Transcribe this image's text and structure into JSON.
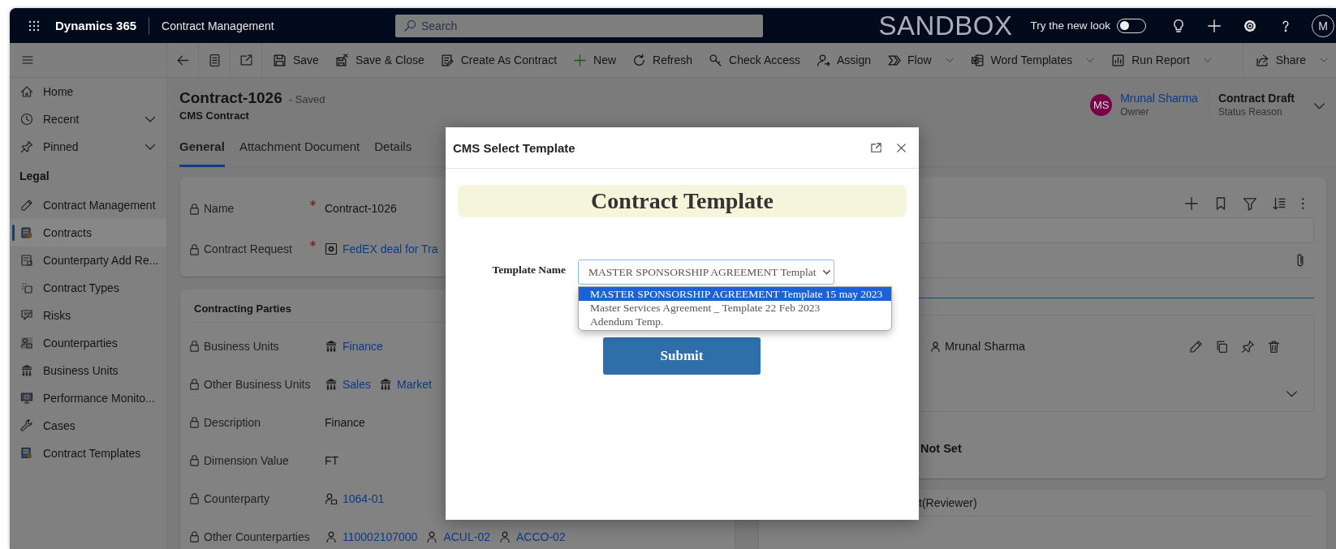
{
  "top_bar": {
    "app_name": "Dynamics 365",
    "area": "Contract Management",
    "search": {
      "placeholder": "Search"
    },
    "environment": "SANDBOX",
    "new_look": {
      "label": "Try the new look",
      "on": false
    },
    "user_initial": "M"
  },
  "command_bar": {
    "items": [
      {
        "label": "Save",
        "kind": "button"
      },
      {
        "label": "Save & Close",
        "kind": "button"
      },
      {
        "label": "Create As Contract",
        "kind": "button"
      },
      {
        "label": "New",
        "kind": "button"
      },
      {
        "label": "Refresh",
        "kind": "button"
      },
      {
        "label": "Check Access",
        "kind": "button"
      },
      {
        "label": "Assign",
        "kind": "button"
      },
      {
        "label": "Flow",
        "kind": "menu"
      },
      {
        "label": "Word Templates",
        "kind": "menu"
      },
      {
        "label": "Run Report",
        "kind": "menu"
      }
    ],
    "share": {
      "label": "Share",
      "kind": "menu"
    }
  },
  "sidebar": {
    "items": [
      {
        "label": "Home",
        "expandable": false,
        "selected": false
      },
      {
        "label": "Recent",
        "expandable": true,
        "selected": false
      },
      {
        "label": "Pinned",
        "expandable": true,
        "selected": false
      }
    ],
    "group": {
      "title": "Legal",
      "items": [
        {
          "label": "Contract Management",
          "selected": false
        },
        {
          "label": "Contracts",
          "selected": true
        },
        {
          "label": "Counterparty Add Re...",
          "selected": false
        },
        {
          "label": "Contract Types",
          "selected": false
        },
        {
          "label": "Risks",
          "selected": false
        },
        {
          "label": "Counterparties",
          "selected": false
        },
        {
          "label": "Business Units",
          "selected": false
        },
        {
          "label": "Performance Monito...",
          "selected": false
        },
        {
          "label": "Cases",
          "selected": false
        },
        {
          "label": "Contract Templates",
          "selected": false
        }
      ]
    }
  },
  "record": {
    "title": "Contract-1026",
    "save_state": "- Saved",
    "entity": "CMS Contract",
    "owner": {
      "initials": "MS",
      "name": "Mrunal Sharma",
      "role": "Owner"
    },
    "status": {
      "value": "Contract Draft",
      "label": "Status Reason"
    }
  },
  "tabs": [
    {
      "label": "General",
      "selected": true
    },
    {
      "label": "Attachment Document",
      "selected": false
    },
    {
      "label": "Details",
      "selected": false
    }
  ],
  "summary_fields": [
    {
      "label": "Name",
      "required": true,
      "value": "Contract-1026",
      "kind": "text"
    },
    {
      "label": "Contract Request",
      "required": true,
      "value": "FedEX deal for Tra",
      "kind": "lookup"
    }
  ],
  "contracting_parties": {
    "title": "Contracting Parties",
    "fields": [
      {
        "label": "Business Units",
        "values": [
          {
            "text": "Finance",
            "kind": "business_unit"
          }
        ]
      },
      {
        "label": "Other Business Units",
        "values": [
          {
            "text": "Sales",
            "kind": "business_unit"
          },
          {
            "text": "Market",
            "kind": "business_unit"
          }
        ]
      },
      {
        "label": "Description",
        "values": [
          {
            "text": "Finance",
            "kind": "text"
          }
        ]
      },
      {
        "label": "Dimension Value",
        "values": [
          {
            "text": "FT",
            "kind": "text"
          }
        ]
      },
      {
        "label": "Counterparty",
        "values": [
          {
            "text": "1064-01",
            "kind": "counterparty"
          }
        ]
      },
      {
        "label": "Other Counterparties",
        "values": [
          {
            "text": "110002107000",
            "kind": "contact"
          },
          {
            "text": "ACUL-02",
            "kind": "contact"
          },
          {
            "text": "ACCO-02",
            "kind": "contact"
          }
        ]
      }
    ]
  },
  "timeline": {
    "author": "Mrunal Sharma",
    "status": "Not Set",
    "section_title": "t(Reviewer)"
  },
  "dialog": {
    "title": "CMS Select Template",
    "heading": "Contract Template",
    "field_label": "Template Name",
    "select": {
      "value": "MASTER SPONSORSHIP AGREEMENT Templat"
    },
    "options": [
      {
        "label": "MASTER SPONSORSHIP AGREEMENT Template 15 may 2023",
        "selected": true
      },
      {
        "label": "Master Services Agreement _ Template 22 Feb 2023",
        "selected": false
      },
      {
        "label": "Adendum Temp.",
        "selected": false
      }
    ],
    "submit": "Submit"
  }
}
